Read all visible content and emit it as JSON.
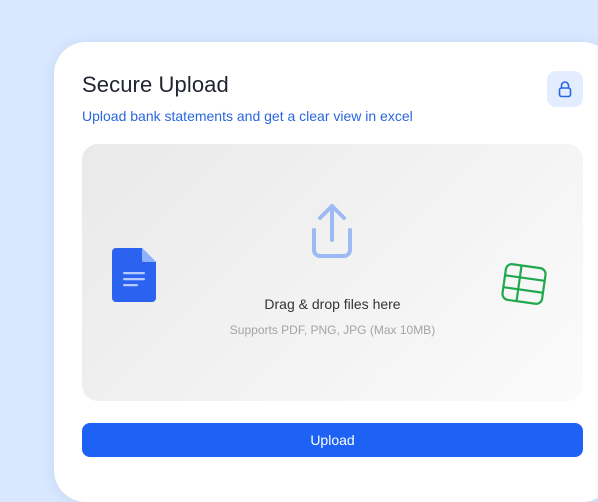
{
  "header": {
    "title": "Secure Upload",
    "subtitle": "Upload bank statements and get a clear view in excel",
    "lock_icon": "lock-icon"
  },
  "dropzone": {
    "title": "Drag & drop files here",
    "hint": "Supports PDF, PNG, JPG (Max 10MB)",
    "icons": [
      "upload-icon",
      "document-icon",
      "spreadsheet-icon"
    ]
  },
  "actions": {
    "upload_label": "Upload"
  },
  "colors": {
    "page_background": "#d9e8ff",
    "accent": "#1d61f5",
    "subtitle": "#2a66e0",
    "upload_icon": "#9dbaf5",
    "document_icon": "#2b63f0",
    "spreadsheet_icon": "#1fa84d"
  }
}
